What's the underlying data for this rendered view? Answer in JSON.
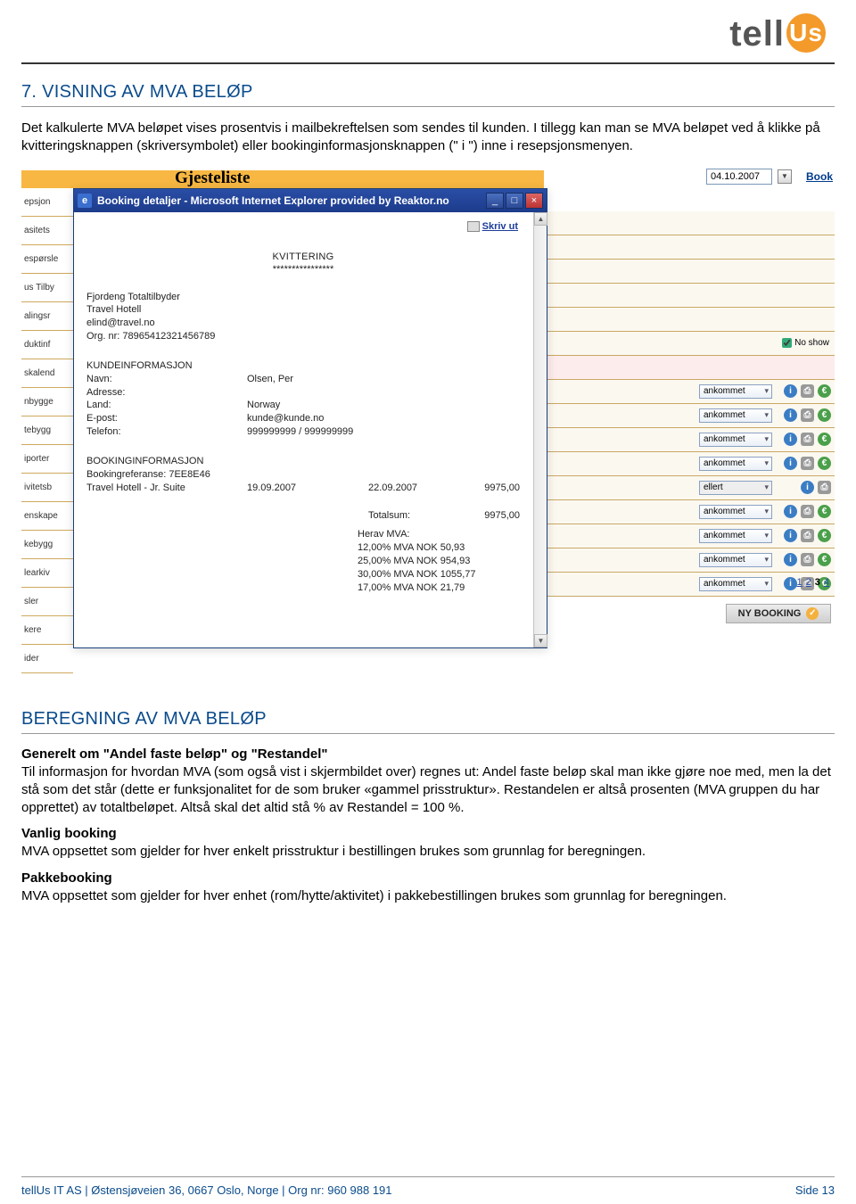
{
  "logo": {
    "text_a": "tell",
    "text_b": "Us"
  },
  "title1": "7. VISNING AV MVA BELØP",
  "intro": "Det kalkulerte MVA beløpet vises prosentvis i mailbekreftelsen som sendes til kunden. I tillegg kan man se MVA beløpet ved å klikke på kvitteringsknappen (skriversymbolet) eller bookinginformasjonsknappen (\" i \") inne i resepsjonsmenyen.",
  "screenshot": {
    "gjesteliste_header": "Gjesteliste",
    "sidebar": [
      "epsjon",
      "asitets",
      "espørsle",
      "us Tilby",
      "alingsr",
      "duktinf",
      "skalend",
      "nbygge",
      "tebygg",
      "iporter",
      "ivitetsb",
      "enskape",
      "kebygg",
      "learkiv",
      "sler",
      "kere",
      "ider"
    ],
    "date_field": "04.10.2007",
    "book_link": "Book",
    "popup": {
      "title": "Booking detaljer - Microsoft Internet Explorer provided by Reaktor.no",
      "skriv_ut": "Skriv ut",
      "kvit_h": "KVITTERING",
      "kvit_s": "****************",
      "provider": [
        "Fjordeng Totaltilbyder",
        "Travel Hotell",
        "elind@travel.no",
        "Org. nr: 78965412321456789"
      ],
      "kunde_h": "KUNDEINFORMASJON",
      "kunde": {
        "navn_l": "Navn:",
        "navn_v": "Olsen, Per",
        "adr_l": "Adresse:",
        "adr_v": "",
        "land_l": "Land:",
        "land_v": "Norway",
        "ep_l": "E-post:",
        "ep_v": "kunde@kunde.no",
        "tel_l": "Telefon:",
        "tel_v": "999999999 / 999999999"
      },
      "book_h": "BOOKINGINFORMASJON",
      "book_ref_l": "Bookingreferanse: 7EE8E46",
      "book_line": {
        "item": "Travel Hotell - Jr. Suite",
        "d1": "19.09.2007",
        "d2": "22.09.2007",
        "amt": "9975,00"
      },
      "total_l": "Totalsum:",
      "total_v": "9975,00",
      "mva_h": "Herav MVA:",
      "mva_lines": [
        "12,00% MVA NOK 50,93",
        "25,00% MVA NOK 954,93",
        "30,00% MVA NOK 1055,77",
        "17,00% MVA NOK 21,79"
      ]
    },
    "row_no_show": "No show",
    "ankommet": "ankommet",
    "ellert": "ellert",
    "pager": [
      "1",
      "2",
      "3",
      "4"
    ],
    "ny_booking": "NY BOOKING"
  },
  "title2": "BEREGNING AV MVA BELØP",
  "gen_h": "Generelt om \"Andel faste beløp\" og \"Restandel\"",
  "gen_p": "Til informasjon for hvordan MVA (som også vist i skjermbildet over) regnes ut: Andel faste beløp skal man ikke gjøre noe med, men la det stå som det står (dette er funksjonalitet for de som bruker «gammel prisstruktur». Restandelen er altså prosenten (MVA gruppen du har opprettet) av totaltbeløpet. Altså skal det altid stå % av Restandel = 100 %.",
  "vanlig_h": "Vanlig booking",
  "vanlig_p": "MVA oppsettet som gjelder for hver enkelt prisstruktur i bestillingen brukes som grunnlag for beregningen.",
  "pakke_h": "Pakkebooking",
  "pakke_p": "MVA oppsettet som gjelder for hver enhet (rom/hytte/aktivitet) i pakkebestillingen brukes som grunnlag for beregningen.",
  "footer_left": "tellUs IT AS | Østensjøveien 36, 0667 Oslo, Norge | Org nr: 960 988 191",
  "footer_right": "Side 13"
}
